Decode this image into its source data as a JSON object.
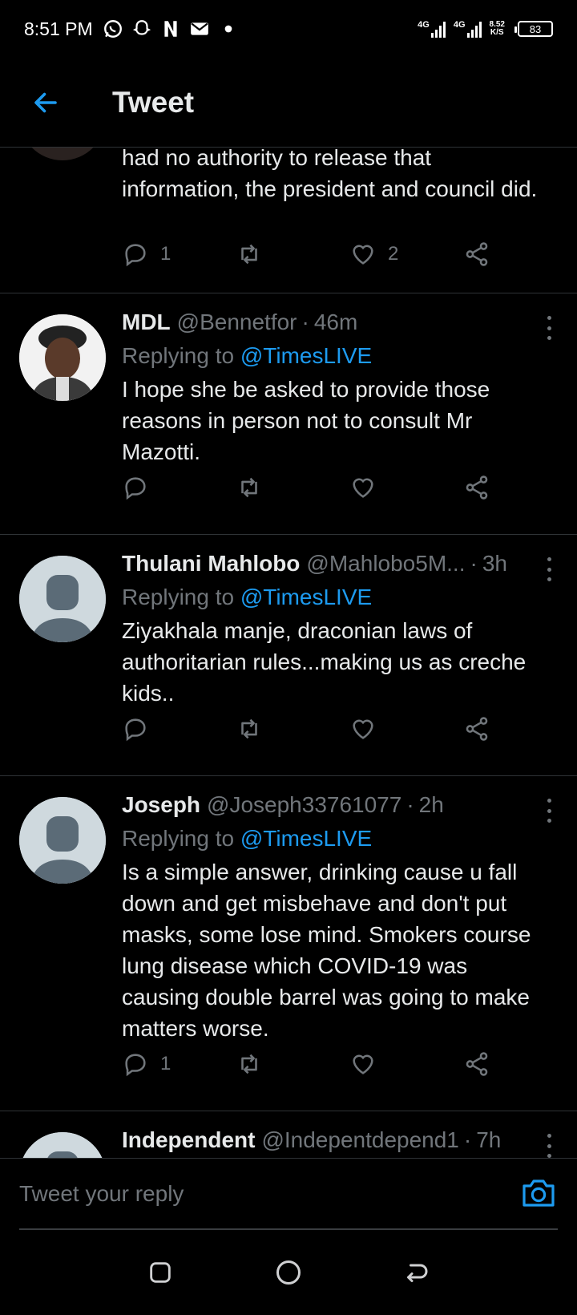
{
  "status_bar": {
    "time": "8:51 PM",
    "notification_icons": [
      "whatsapp-icon",
      "snapchat-icon",
      "netflix-icon",
      "mail-icon",
      "dot-icon"
    ],
    "network_1": "4G",
    "network_2": "4G",
    "speed_value": "8.52",
    "speed_unit": "K/S",
    "battery": "83"
  },
  "header": {
    "title": "Tweet",
    "back_icon": "arrow-left-icon"
  },
  "tweets": [
    {
      "name": "",
      "handle": "",
      "time": "",
      "replying_to": "",
      "text": "had no authority to release that information, the president and council did.",
      "replies": "1",
      "retweets": "",
      "likes": "2"
    },
    {
      "name": "MDL",
      "handle": "@Bennetfor",
      "sep": "·",
      "time": "46m",
      "replying_label": "Replying to",
      "replying_to": "@TimesLIVE",
      "text": "I hope she be asked to provide those reasons in person not to consult Mr Mazotti.",
      "replies": "",
      "retweets": "",
      "likes": ""
    },
    {
      "name": "Thulani Mahlobo",
      "handle": "@Mahlobo5M...",
      "sep": "·",
      "time": "3h",
      "replying_label": "Replying to",
      "replying_to": "@TimesLIVE",
      "text": "Ziyakhala manje, draconian laws of authoritarian rules...making us as creche kids..",
      "replies": "",
      "retweets": "",
      "likes": ""
    },
    {
      "name": "Joseph",
      "handle": "@Joseph33761077",
      "sep": "·",
      "time": "2h",
      "replying_label": "Replying to",
      "replying_to": "@TimesLIVE",
      "text": "Is a simple answer, drinking cause u fall down and get misbehave and don't put masks, some lose mind. Smokers course lung disease which COVID-19 was causing double barrel was going to make matters worse.",
      "replies": "1",
      "retweets": "",
      "likes": ""
    },
    {
      "name": "Independent",
      "handle": "@Indepentdepend1",
      "sep": "·",
      "time": "7h"
    }
  ],
  "reply_bar": {
    "placeholder": "Tweet your reply",
    "camera_icon": "camera-icon"
  },
  "colors": {
    "accent": "#1d9bf0",
    "background": "#000000",
    "secondary_text": "#71767b",
    "divider": "#2f3336"
  }
}
